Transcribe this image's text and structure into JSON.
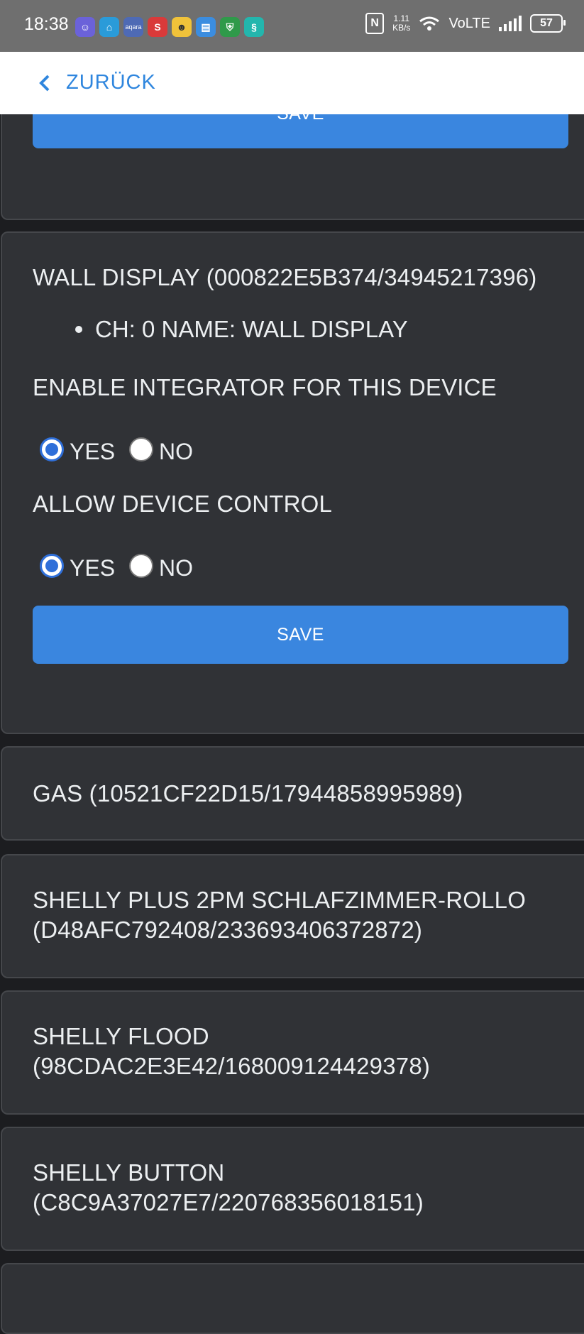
{
  "status_bar": {
    "time": "18:38",
    "speed_value": "1.11",
    "speed_unit": "KB/s",
    "network_label": "VoLTE",
    "battery_level": "57",
    "notification_icons": [
      "teams-icon",
      "home-app-icon",
      "aqara-icon",
      "s-app-icon",
      "chat-app-icon",
      "clipboard-app-icon",
      "shield-app-icon",
      "s-circle-app-icon"
    ]
  },
  "header": {
    "back_label": "ZURÜCK"
  },
  "top_card": {
    "save_label": "SAVE"
  },
  "wall_card": {
    "title": "WALL DISPLAY (000822E5B374/34945217396)",
    "channel": "CH: 0 NAME: WALL DISPLAY",
    "integrator_label": "ENABLE INTEGRATOR FOR THIS DEVICE",
    "control_label": "ALLOW DEVICE CONTROL",
    "yes_label": "YES",
    "no_label": "NO",
    "save_label": "SAVE"
  },
  "devices": [
    {
      "title": "GAS (10521CF22D15/17944858995989)"
    },
    {
      "title_line1": "SHELLY PLUS 2PM SCHLAFZIMMER-ROLLO",
      "title_line2": "(D48AFC792408/233693406372872)"
    },
    {
      "title_line1": "SHELLY FLOOD",
      "title_line2": "(98CDAC2E3E42/168009124429378)"
    },
    {
      "title_line1": "SHELLY BUTTON",
      "title_line2": "(C8C9A37027E7/220768356018151)"
    }
  ],
  "colors": {
    "accent": "#3a86df",
    "header_text": "#2f86de",
    "card_bg": "#303236",
    "page_bg": "#1c1d20"
  }
}
